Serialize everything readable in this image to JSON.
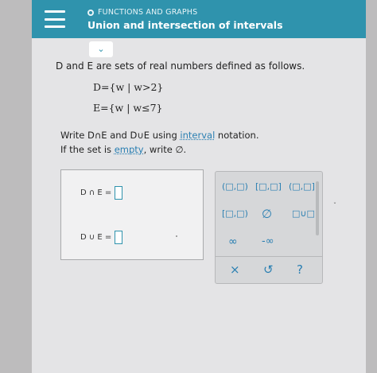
{
  "header": {
    "subtitle": "FUNCTIONS AND GRAPHS",
    "title": "Union and intersection of intervals",
    "expand_glyph": "⌄"
  },
  "problem": {
    "intro": "D and E are sets of real numbers defined as follows.",
    "set_d": "D={w | w>2}",
    "set_e": "E={w | w≤7}",
    "instruction_pre": "Write D∩E and D∪E using ",
    "instruction_link": "interval",
    "instruction_post": " notation.",
    "empty_pre": "If the set is ",
    "empty_link": "empty",
    "empty_post": ", write ∅."
  },
  "answers": {
    "intersection_label": "D ∩ E =",
    "union_label": "D ∪ E ="
  },
  "keypad": {
    "k_open_open": "(□,□)",
    "k_closed_closed": "[□,□]",
    "k_open_closed": "(□,□]",
    "k_closed_open": "[□,□)",
    "k_empty": "∅",
    "k_union": "□∪□",
    "k_inf": "∞",
    "k_neg_inf": "-∞",
    "k_clear": "×",
    "k_undo": "↺",
    "k_help": "?"
  },
  "colors": {
    "header": "#2f93ad",
    "link": "#2a7fb2"
  }
}
